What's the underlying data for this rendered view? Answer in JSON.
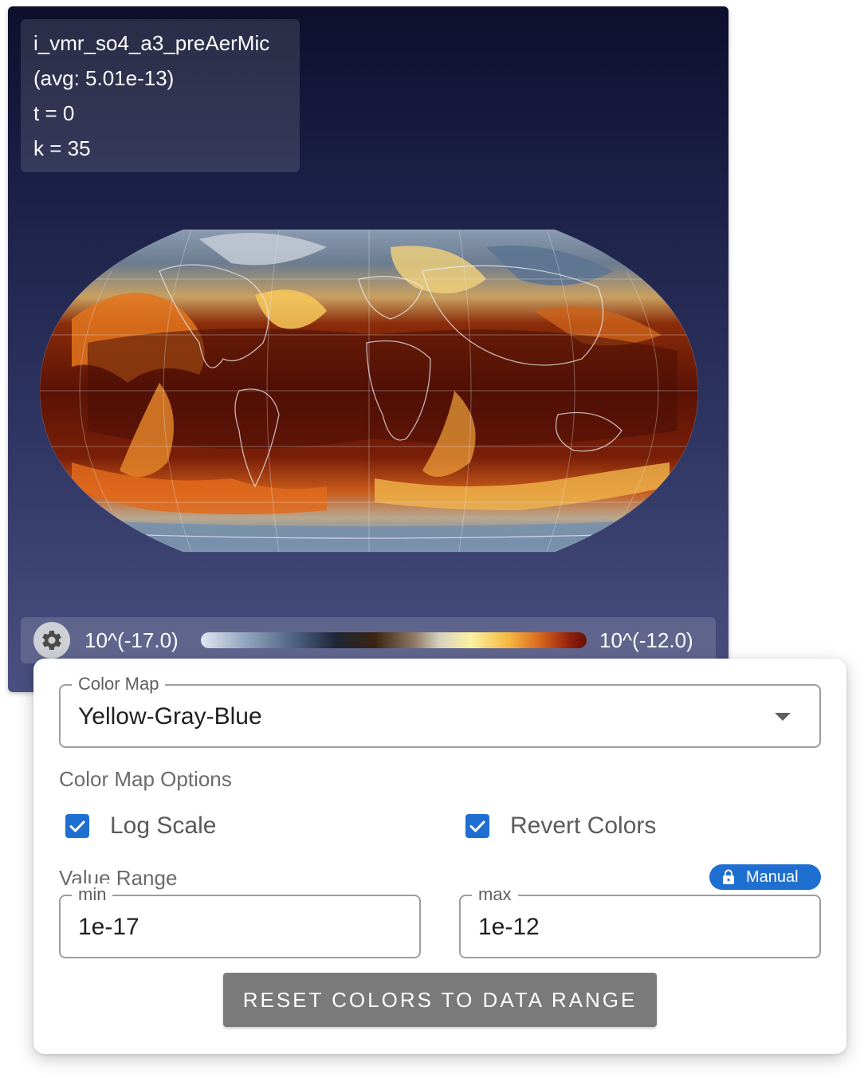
{
  "viz": {
    "variable_name": "i_vmr_so4_a3_preAerMic",
    "avg_label": "(avg: 5.01e-13)",
    "time_label": "t = 0",
    "level_label": "k = 35",
    "colorbar": {
      "min_label": "10^(-17.0)",
      "max_label": "10^(-12.0)"
    }
  },
  "settings": {
    "color_map": {
      "label": "Color Map",
      "value": "Yellow-Gray-Blue"
    },
    "options_title": "Color Map Options",
    "log_scale": {
      "label": "Log Scale",
      "checked": true
    },
    "revert_colors": {
      "label": "Revert Colors",
      "checked": true
    },
    "value_range": {
      "title": "Value Range",
      "badge": "Manual",
      "min_label": "min",
      "min_value": "1e-17",
      "max_label": "max",
      "max_value": "1e-12"
    },
    "reset_button": "RESET COLORS TO DATA RANGE"
  },
  "colors": {
    "accent": "#1e6fd0",
    "reset_button_bg": "#7a7a7a",
    "viz_background_top": "#0d0f2c",
    "viz_background_bottom": "#4a5080"
  },
  "icons": {
    "settings": "gear-icon",
    "dropdown": "chevron-down-icon",
    "checkbox": "check-icon",
    "badge": "lock-icon"
  }
}
